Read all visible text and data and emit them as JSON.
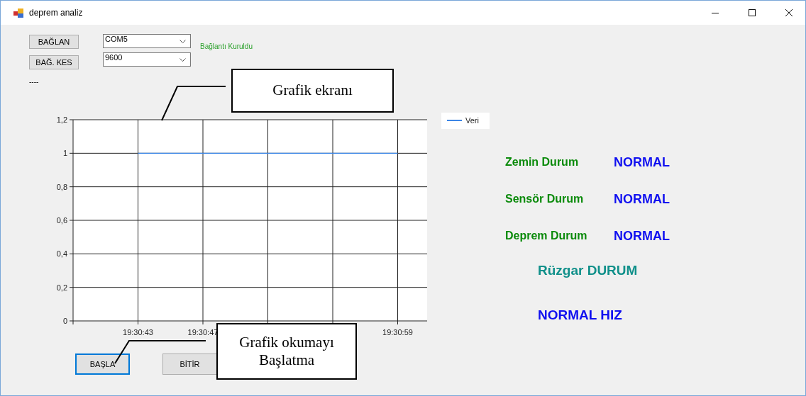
{
  "window": {
    "title": "deprem analiz"
  },
  "connection": {
    "connect_button": "BAĞLAN",
    "disconnect_button": "BAĞ. KES",
    "port": "COM5",
    "baud": "9600",
    "status": "Bağlantı Kuruldu",
    "info": "----"
  },
  "chart": {
    "chart_data": {
      "type": "line",
      "grid": true,
      "categories": [
        null,
        "19:30:43",
        "19:30:47",
        null,
        null,
        "19:30:59"
      ],
      "series": [
        {
          "name": "Veri",
          "color": "#3c86e6",
          "values": [
            null,
            1,
            1,
            1,
            1,
            1
          ]
        }
      ],
      "ylim": [
        0,
        1.2
      ],
      "yticks": [
        {
          "value": 0,
          "label": "0"
        },
        {
          "value": 0.2,
          "label": "0,2"
        },
        {
          "value": 0.4,
          "label": "0,4"
        },
        {
          "value": 0.6,
          "label": "0,6"
        },
        {
          "value": 0.8,
          "label": "0,8"
        },
        {
          "value": 1,
          "label": "1"
        },
        {
          "value": 1.2,
          "label": "1,2"
        }
      ]
    }
  },
  "status_rows": [
    {
      "label": "Zemin Durum",
      "value": "NORMAL"
    },
    {
      "label": "Sensör Durum",
      "value": "NORMAL"
    },
    {
      "label": "Deprem Durum",
      "value": "NORMAL"
    }
  ],
  "wind": {
    "title": "Rüzgar DURUM",
    "value": "NORMAL HIZ"
  },
  "buttons": [
    {
      "label": "BAŞLA",
      "focused": true
    },
    {
      "label": "BİTİR",
      "focused": false
    }
  ],
  "callouts": [
    {
      "text": "Grafik ekranı"
    },
    {
      "text": "Grafik okumayı\nBaşlatma"
    }
  ]
}
